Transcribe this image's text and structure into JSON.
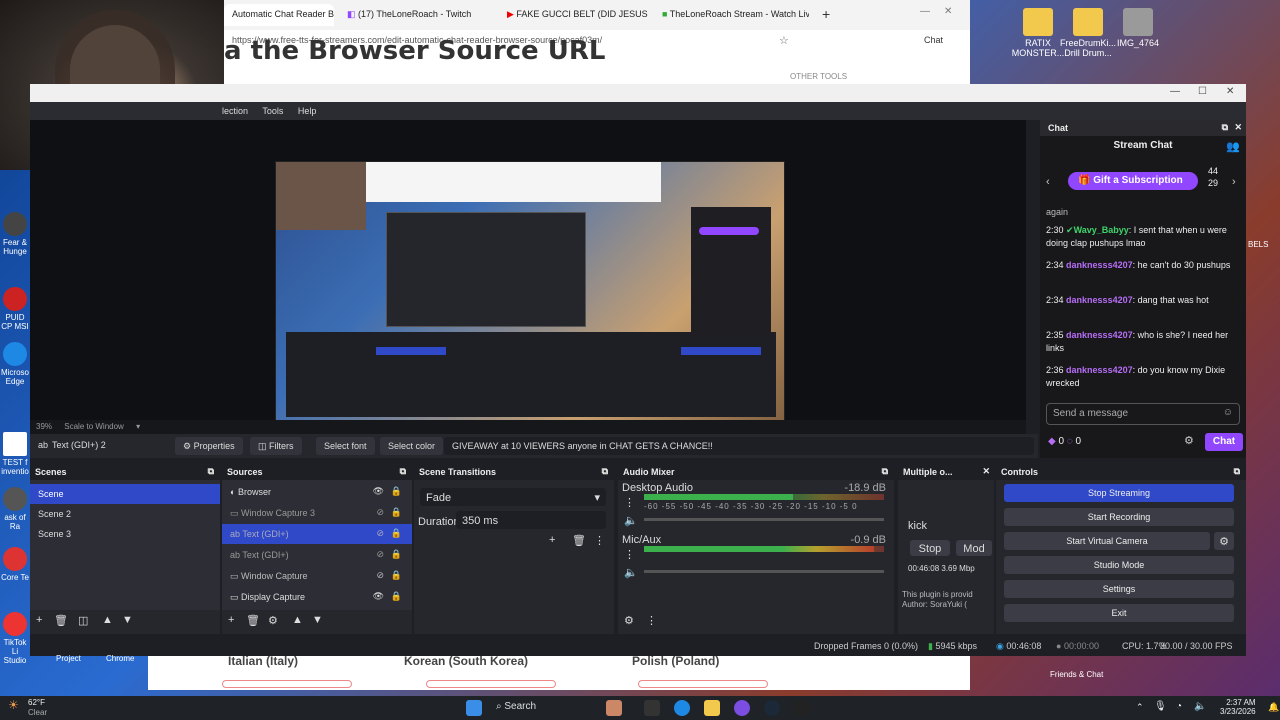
{
  "desktop": {
    "icons": [
      {
        "label": "RATIX MONSTER..."
      },
      {
        "label": "FreeDrumKi... Drill Drum..."
      },
      {
        "label": "IMG_4764"
      }
    ],
    "left_icons": [
      "Fear & Hunge",
      "PUID CP MSI",
      "Microso Edge",
      "TEST f inventio",
      "ask of Ra",
      "Core Te",
      "TikTok Li Studio"
    ],
    "right_label": "BELS"
  },
  "browser": {
    "tabs": [
      {
        "title": "Automatic Chat Reader B"
      },
      {
        "title": "(17) TheLoneRoach - Twitch"
      },
      {
        "title": "FAKE GUCCI BELT (DID JESUS"
      },
      {
        "title": "TheLoneRoach Stream - Watch Liv"
      }
    ],
    "url": "https://www.free-tts-for-streamers.com/edit-automatic-chat-reader-browser-source/pocaf03m/",
    "heading": "a the Browser Source URL",
    "other_tools": "OTHER TOOLS",
    "profile_label": "Chat"
  },
  "obs": {
    "menu": [
      "lection",
      "Tools",
      "Help"
    ],
    "zoom": "39%",
    "scale_mode": "Scale to Window",
    "source_name": "Text (GDI+) 2",
    "source_toolbar": {
      "properties": "Properties",
      "filters": "Filters",
      "select_font": "Select font",
      "select_color": "Select color",
      "text": "GIVEAWAY at 10 VIEWERS anyone in CHAT GETS A CHANCE!!"
    },
    "scenes": {
      "title": "Scenes",
      "items": [
        "Scene",
        "Scene 2",
        "Scene 3"
      ]
    },
    "sources": {
      "title": "Sources",
      "items": [
        {
          "name": "Browser"
        },
        {
          "name": "Window Capture 3"
        },
        {
          "name": "Text (GDI+)"
        },
        {
          "name": "Text (GDI+)"
        },
        {
          "name": "Window Capture"
        },
        {
          "name": "Display Capture"
        }
      ]
    },
    "transitions": {
      "title": "Scene Transitions",
      "type": "Fade",
      "duration_label": "Duration",
      "duration_value": "350 ms"
    },
    "mixer": {
      "title": "Audio Mixer",
      "channels": [
        {
          "name": "Desktop Audio",
          "db": "-18.9 dB",
          "level": 0.62
        },
        {
          "name": "Mic/Aux",
          "db": "-0.9 dB",
          "level": 0.96
        }
      ],
      "scale": [
        "-60",
        "-55",
        "-50",
        "-45",
        "-40",
        "-35",
        "-30",
        "-25",
        "-20",
        "-15",
        "-10",
        "-5",
        "0"
      ]
    },
    "multiple_output": {
      "title": "Multiple o...",
      "kick_label": "kick",
      "stop_label": "Stop",
      "mod_label": "Mod",
      "time": "00:46:08",
      "bitrate": "3.69 Mbp",
      "plugin_line1": "This plugin is provid",
      "plugin_line2": "Author: SoraYuki ("
    },
    "controls": {
      "title": "Controls",
      "buttons": [
        "Stop Streaming",
        "Start Recording",
        "Start Virtual Camera",
        "Studio Mode",
        "Settings",
        "Exit"
      ]
    },
    "chat": {
      "title": "Chat",
      "stream_chat": "Stream Chat",
      "gift": "Gift a Subscription",
      "gift_counts": [
        "44",
        "29"
      ],
      "partial_text": "again",
      "messages": [
        {
          "time": "2:30",
          "user": "Wavy_Babyy",
          "text": ": I sent that when u were doing clap pushups lmao"
        },
        {
          "time": "2:34",
          "user": "danknesss4207",
          "text": ": he can't do 30 pushups"
        },
        {
          "time": "2:34",
          "user": "danknesss4207",
          "text": ": dang that was hot"
        },
        {
          "time": "2:35",
          "user": "danknesss4207",
          "text": ": who is she? I need her links"
        },
        {
          "time": "2:36",
          "user": "danknesss4207",
          "text": ": do you know my Dixie wrecked"
        }
      ],
      "input_placeholder": "Send a message",
      "points": "0",
      "points2": "0",
      "chat_button": "Chat"
    },
    "status": {
      "dropped": "Dropped Frames 0 (0.0%)",
      "kbps": "5945 kbps",
      "live_time": "00:46:08",
      "rec_time": "00:00:00",
      "cpu": "CPU: 1.7%",
      "fps": "30.00 / 30.00 FPS"
    }
  },
  "browser_bottom": {
    "langs": [
      "Italian (Italy)",
      "Korean (South Korea)",
      "Polish (Poland)"
    ],
    "friends": "Friends & Chat",
    "project": "Project",
    "chrome": "Chrome"
  },
  "taskbar": {
    "weather_temp": "62°F",
    "weather_desc": "Clear",
    "search": "Search",
    "time": "2:37 AM",
    "date": "3/23/2026"
  }
}
